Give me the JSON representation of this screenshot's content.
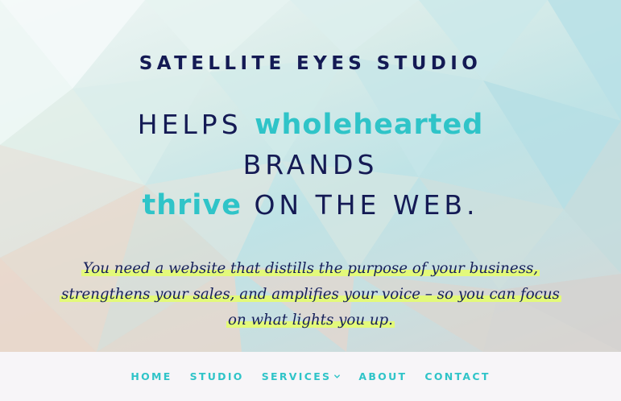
{
  "hero": {
    "brand": "SATELLITE EYES STUDIO",
    "headline": {
      "line1_prefix": "HELPS",
      "line1_accent": "wholehearted",
      "line2": "BRANDS",
      "line3_accent": "thrive",
      "line3_suffix": "ON THE WEB."
    },
    "tagline": {
      "line1": "You need a website that distills the purpose of your business,",
      "line2": "strengthens your sales, and amplifies your voice – so you can focus",
      "line3": "on what lights you up."
    }
  },
  "nav": {
    "items": [
      {
        "label": "HOME"
      },
      {
        "label": "STUDIO"
      },
      {
        "label": "SERVICES"
      },
      {
        "label": "ABOUT"
      },
      {
        "label": "CONTACT"
      }
    ]
  },
  "colors": {
    "navy": "#141a54",
    "teal": "#2fc4c8",
    "highlight": "#e3f97a",
    "nav_bg": "#f7f5f8"
  },
  "icons": {
    "services_dropdown": "chevron-down-icon"
  }
}
